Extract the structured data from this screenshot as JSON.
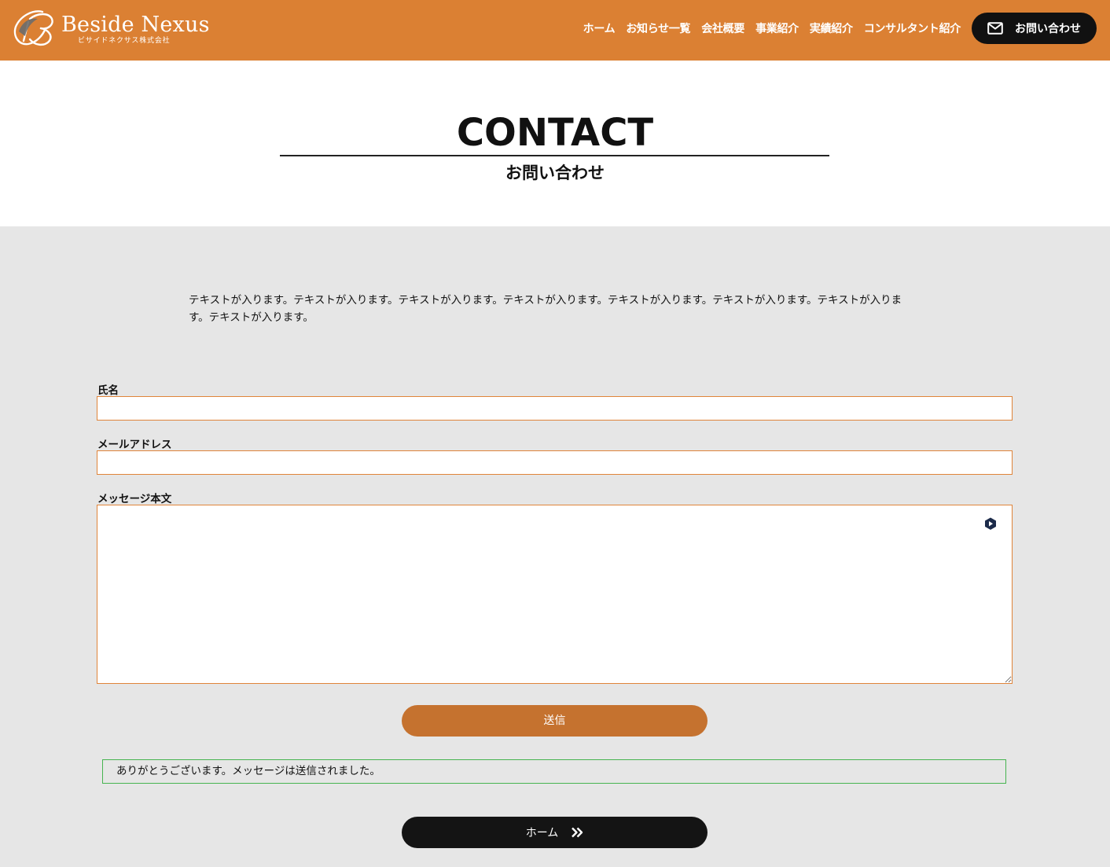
{
  "header": {
    "brand_name": "Beside Nexus",
    "brand_sub": "ビサイドネクサス株式会社",
    "nav": [
      {
        "label": "ホーム"
      },
      {
        "label": "お知らせ一覧"
      },
      {
        "label": "会社概要"
      },
      {
        "label": "事業紹介"
      },
      {
        "label": "実績紹介"
      },
      {
        "label": "コンサルタント紹介"
      }
    ],
    "contact_button": {
      "label": "お問い合わせ",
      "icon": "mail-icon"
    },
    "background_color": "#db8033"
  },
  "hero": {
    "title": "CONTACT",
    "subtitle": "お問い合わせ"
  },
  "intro": {
    "text": "テキストが入ります。テキストが入ります。テキストが入ります。テキストが入ります。テキストが入ります。テキストが入ります。テキストが入ります。テキストが入ります。"
  },
  "form": {
    "name_label": "氏名",
    "name_value": "",
    "email_label": "メールアドレス",
    "email_value": "",
    "message_label": "メッセージ本文",
    "message_value": "",
    "submit_label": "送信",
    "field_border_color": "#e0843a",
    "submit_color": "#c5722f"
  },
  "success_message": {
    "text": "ありがとうございます。メッセージは送信されました。",
    "border_color": "#46b450"
  },
  "home_button": {
    "label": "ホーム",
    "icon": "double-chevron-right-icon"
  }
}
